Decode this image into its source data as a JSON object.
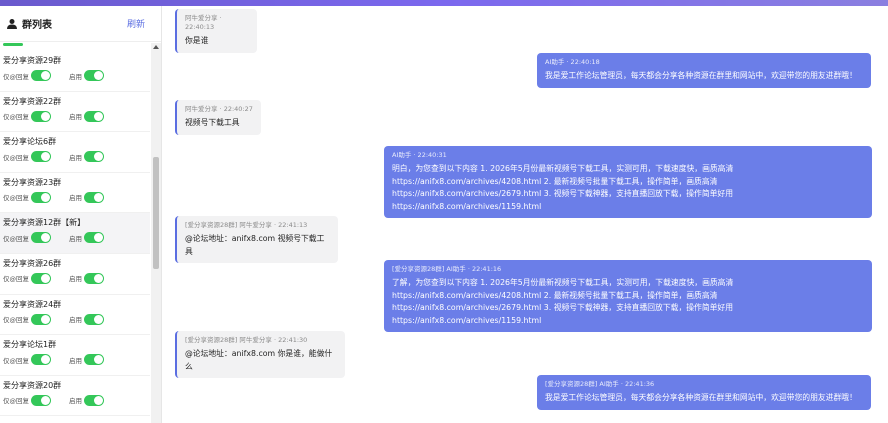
{
  "sidebar": {
    "title": "群列表",
    "refresh_label": "刷新",
    "groups": [
      {
        "name": "爱分享资源29群",
        "mention_label": "仅@回复",
        "enable_label": "启用"
      },
      {
        "name": "爱分享资源22群",
        "mention_label": "仅@回复",
        "enable_label": "启用"
      },
      {
        "name": "爱分享论坛6群",
        "mention_label": "仅@回复",
        "enable_label": "启用"
      },
      {
        "name": "爱分享资源23群",
        "mention_label": "仅@回复",
        "enable_label": "启用"
      },
      {
        "name": "爱分享资源12群【新】",
        "mention_label": "仅@回复",
        "enable_label": "启用"
      },
      {
        "name": "爱分享资源26群",
        "mention_label": "仅@回复",
        "enable_label": "启用"
      },
      {
        "name": "爱分享资源24群",
        "mention_label": "仅@回复",
        "enable_label": "启用"
      },
      {
        "name": "爱分享论坛1群",
        "mention_label": "仅@回复",
        "enable_label": "启用"
      },
      {
        "name": "爱分享资源20群",
        "mention_label": "仅@回复",
        "enable_label": "启用"
      }
    ]
  },
  "messages": [
    {
      "meta": "阿牛爱分享 · 22:40:13",
      "text": "你是谁"
    },
    {
      "meta": "AI助手 · 22:40:18",
      "text": "我是爱工作论坛管理员，每天都会分享各种资源在群里和网站中，欢迎带您的朋友进群哦！"
    },
    {
      "meta": "阿牛爱分享 · 22:40:27",
      "text": "视频号下载工具"
    },
    {
      "meta": "AI助手 · 22:40:31",
      "text": "明白，为您查到以下内容 1. 2026年5月份最新视频号下载工具，实测可用，下载速度快，画质高清 https://anifx8.com/archives/4208.html 2. 最新视频号批量下载工具，操作简单，画质高清 https://anifx8.com/archives/2679.html 3. 视频号下载神器，支持直播回放下载，操作简单好用 https://anifx8.com/archives/1159.html"
    },
    {
      "meta": "[爱分享资源28群] 阿牛爱分享 · 22:41:13",
      "text": "@论坛地址：anifx8.com 视频号下载工具"
    },
    {
      "meta": "[爱分享资源28群] AI助手 · 22:41:16",
      "text": "了解，为您查到以下内容 1. 2026年5月份最新视频号下载工具，实测可用，下载速度快，画质高清 https://anifx8.com/archives/4208.html 2. 最新视频号批量下载工具，操作简单，画质高清 https://anifx8.com/archives/2679.html 3. 视频号下载神器，支持直播回放下载，操作简单好用 https://anifx8.com/archives/1159.html"
    },
    {
      "meta": "[爱分享资源28群] 阿牛爱分享 · 22:41:30",
      "text": "@论坛地址：anifx8.com 你是谁，能做什么"
    },
    {
      "meta": "[爱分享资源28群] AI助手 · 22:41:36",
      "text": "我是爱工作论坛管理员，每天都会分享各种资源在群里和网站中，欢迎带您的朋友进群哦！"
    }
  ],
  "colors": {
    "accent": "#6b7ee8",
    "toggle_on": "#34c759"
  }
}
